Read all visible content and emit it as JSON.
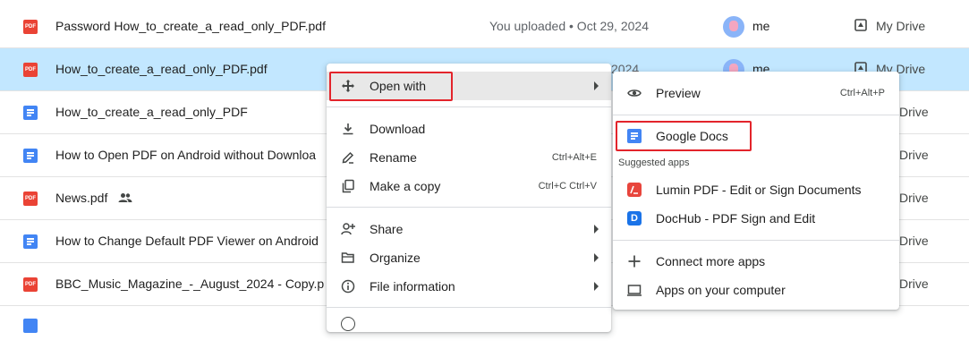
{
  "file_list": {
    "rows": [
      {
        "icon": "pdf-icon",
        "name": "Password How_to_create_a_read_only_PDF.pdf",
        "meta": "You uploaded • Oct 29, 2024",
        "owner": "me",
        "location": "My Drive"
      },
      {
        "icon": "pdf-icon",
        "name": "How_to_create_a_read_only_PDF.pdf",
        "meta": "2024",
        "owner": "me",
        "location": "My Drive"
      },
      {
        "icon": "docs-icon",
        "name": "How_to_create_a_read_only_PDF",
        "meta": "",
        "owner": "",
        "location": "Drive"
      },
      {
        "icon": "docs-icon",
        "name": "How to Open PDF on Android without Downloa",
        "meta": "",
        "owner": "",
        "location": "Drive"
      },
      {
        "icon": "pdf-icon",
        "name": "News.pdf",
        "meta": "",
        "owner": "",
        "location": "Drive"
      },
      {
        "icon": "docs-icon",
        "name": "How to Change Default PDF Viewer on Android",
        "meta": "",
        "owner": "",
        "location": "Drive"
      },
      {
        "icon": "pdf-icon",
        "name": "BBC_Music_Magazine_-_August_2024 - Copy.p",
        "meta": "",
        "owner": "",
        "location": "Drive"
      }
    ],
    "pdf_badge": "PDF"
  },
  "context_menu": {
    "open_with": "Open with",
    "download": "Download",
    "rename": "Rename",
    "rename_shortcut": "Ctrl+Alt+E",
    "make_copy": "Make a copy",
    "make_copy_shortcut": "Ctrl+C Ctrl+V",
    "share": "Share",
    "organize": "Organize",
    "file_information": "File information"
  },
  "open_with_submenu": {
    "preview": "Preview",
    "preview_shortcut": "Ctrl+Alt+P",
    "google_docs": "Google Docs",
    "suggested_apps": "Suggested apps",
    "lumin": "Lumin PDF - Edit or Sign Documents",
    "dochub": "DocHub - PDF Sign and Edit",
    "dochub_letter": "D",
    "connect_more_apps": "Connect more apps",
    "apps_on_computer": "Apps on your computer"
  },
  "colors": {
    "selected_row": "#c2e7ff",
    "pdf_red": "#ea4335",
    "docs_blue": "#4285f4",
    "highlight_red": "#e3242b"
  }
}
